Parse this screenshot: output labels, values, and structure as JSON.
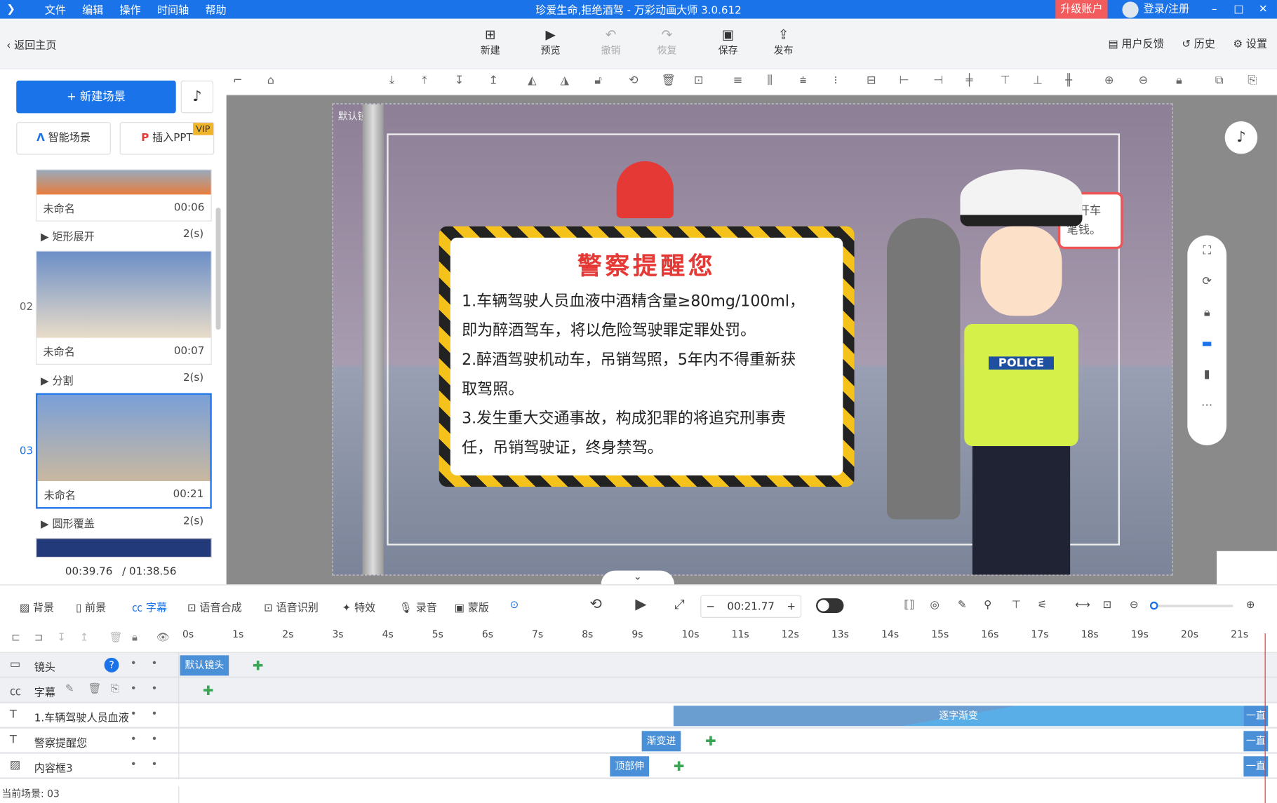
{
  "window": {
    "title": "珍爱生命,拒绝酒驾 - 万彩动画大师 3.0.612",
    "menu": [
      "文件",
      "编辑",
      "操作",
      "时间轴",
      "帮助"
    ],
    "upgrade": "升级账户",
    "login": "登录/注册"
  },
  "toolbar": {
    "back": "返回主页",
    "buttons": [
      {
        "label": "新建",
        "icon": "new-icon"
      },
      {
        "label": "预览",
        "icon": "play-icon"
      },
      {
        "label": "撤销",
        "icon": "undo-icon"
      },
      {
        "label": "恢复",
        "icon": "redo-icon"
      },
      {
        "label": "保存",
        "icon": "save-icon"
      },
      {
        "label": "发布",
        "icon": "publish-icon"
      }
    ],
    "feedback": "用户反馈",
    "history": "历史",
    "settings": "设置"
  },
  "sidebar": {
    "new_scene": "+ 新建场景",
    "smart_scene": "智能场景",
    "insert_ppt": "插入PPT",
    "vip": "VIP",
    "scenes": [
      {
        "name": "未命名",
        "duration": "00:06"
      },
      {
        "number": "02",
        "name": "未命名",
        "duration": "00:07"
      },
      {
        "number": "03",
        "name": "未命名",
        "duration": "00:21"
      }
    ],
    "transitions": [
      {
        "name": "矩形展开",
        "duration": "2(s)"
      },
      {
        "name": "分割",
        "duration": "2(s)"
      },
      {
        "name": "圆形覆盖",
        "duration": "2(s)"
      }
    ],
    "current_time": "00:39.76",
    "total_time": "/ 01:38.56"
  },
  "canvas": {
    "camera_label": "默认镜头",
    "board_title": "警察提醒您",
    "board_text": "1.车辆驾驶人员血液中酒精含量≥80mg/100ml，\n即为醉酒驾车，将以危险驾驶罪定罪处罚。\n2.醉酒驾驶机动车，吊销驾照，5年内不得重新获\n取驾照。\n3.发生重大交通事故，构成犯罪的将追究刑事责\n任，吊销驾驶证，终身禁驾。",
    "vest_text": "POLICE",
    "bubble_text": "，开车\n笔钱。"
  },
  "timeline": {
    "tabs": [
      "背景",
      "前景",
      "字幕",
      "语音合成",
      "语音识别",
      "特效",
      "录音",
      "蒙版"
    ],
    "active_tab": "字幕",
    "time": "00:21.77",
    "ticks": [
      "0s",
      "1s",
      "2s",
      "3s",
      "4s",
      "5s",
      "6s",
      "7s",
      "8s",
      "9s",
      "10s",
      "11s",
      "12s",
      "13s",
      "14s",
      "15s",
      "16s",
      "17s",
      "18s",
      "19s",
      "20s",
      "21s"
    ],
    "tracks": [
      {
        "name": "镜头",
        "clip": "默认镜头"
      },
      {
        "name": "字幕"
      },
      {
        "name": "1.车辆驾驶人员血液",
        "clip": "逐字渐变",
        "end": "一直"
      },
      {
        "name": "警察提醒您",
        "clip": "渐变进",
        "end": "一直"
      },
      {
        "name": "内容框3",
        "clip": "顶部伸",
        "end": "一直"
      }
    ],
    "status": "当前场景: 03"
  }
}
